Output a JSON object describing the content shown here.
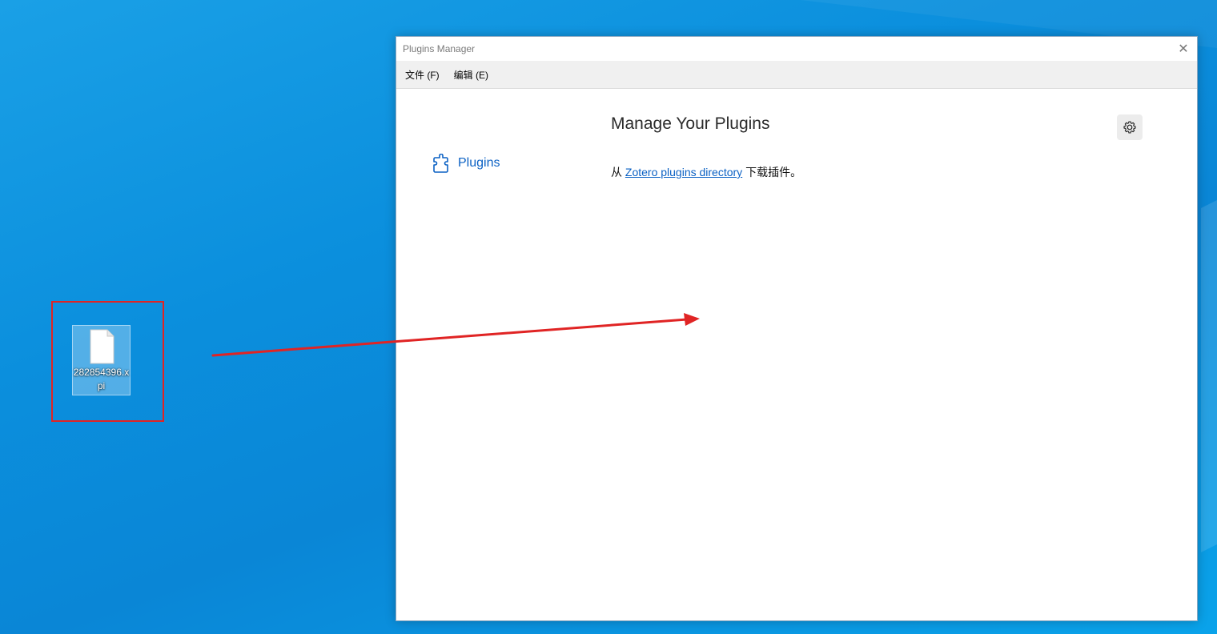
{
  "desktop": {
    "file_icon_label": "282854396.\nxpi",
    "file_name": "282854396.xpi"
  },
  "window": {
    "title": "Plugins Manager",
    "close_glyph": "✕",
    "menu": {
      "file": "文件 (F)",
      "edit": "编辑 (E)"
    },
    "sidebar": {
      "items": [
        {
          "label": "Plugins",
          "icon": "puzzle-piece-icon"
        }
      ]
    },
    "main": {
      "title": "Manage Your Plugins",
      "intro_prefix": "从 ",
      "intro_link": "Zotero plugins directory",
      "intro_suffix": " 下载插件。"
    },
    "settings_icon": "gear-icon"
  },
  "colors": {
    "desktop_bg": "#0b8fdd",
    "link": "#0b61c4",
    "annotation": "#e02424"
  }
}
